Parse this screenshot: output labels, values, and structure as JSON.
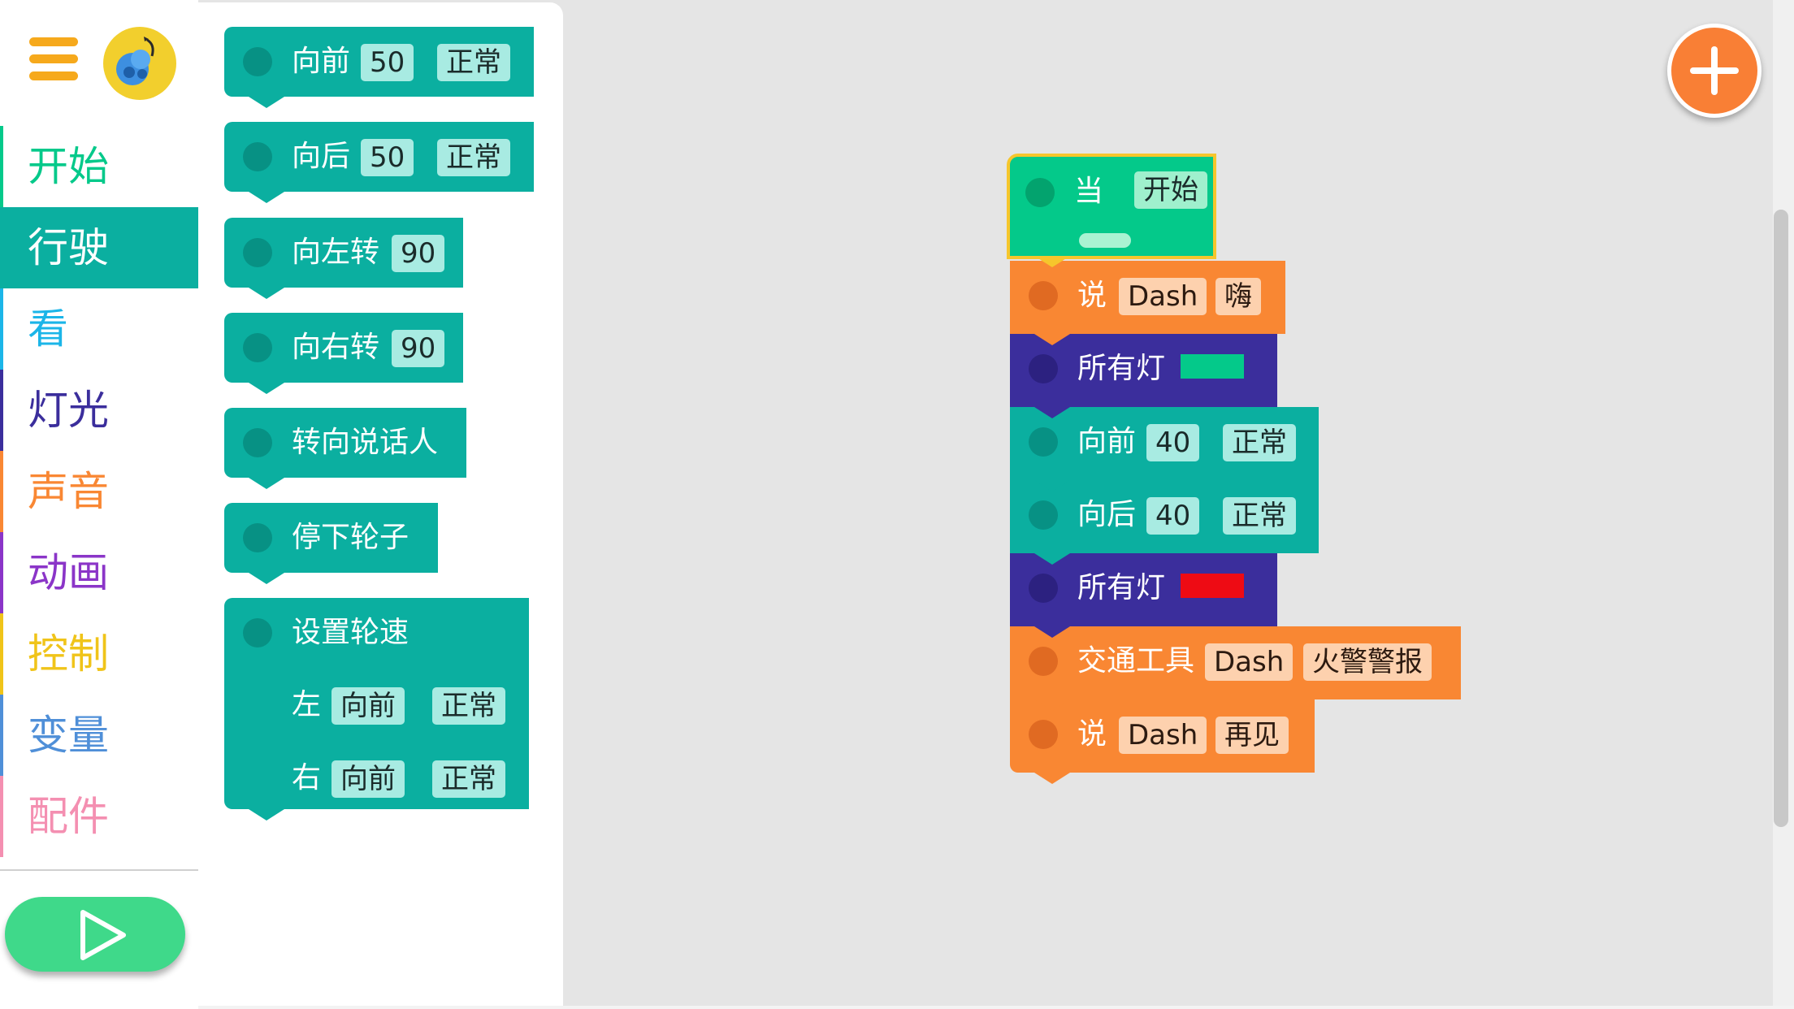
{
  "sidebar": {
    "categories": [
      {
        "label": "开始",
        "color": "#04c98a"
      },
      {
        "label": "行驶",
        "color": "#0bafa0"
      },
      {
        "label": "看",
        "color": "#1bb5e8"
      },
      {
        "label": "灯光",
        "color": "#3b2e9c"
      },
      {
        "label": "声音",
        "color": "#f98733"
      },
      {
        "label": "动画",
        "color": "#8b35c8"
      },
      {
        "label": "控制",
        "color": "#f0c419"
      },
      {
        "label": "变量",
        "color": "#4f8fd8"
      },
      {
        "label": "配件",
        "color": "#f48fb1"
      }
    ],
    "selected": "行驶",
    "menu_icon": "hamburger-menu-icon",
    "avatar_icon": "dash-robot-avatar-icon",
    "run_icon": "play-icon"
  },
  "palette": {
    "forward": {
      "label": "向前",
      "value": "50",
      "speed": "正常"
    },
    "backward": {
      "label": "向后",
      "value": "50",
      "speed": "正常"
    },
    "turn_left": {
      "label": "向左转",
      "value": "90"
    },
    "turn_right": {
      "label": "向右转",
      "value": "90"
    },
    "turn_to_speaker": {
      "label": "转向说话人"
    },
    "stop_wheels": {
      "label": "停下轮子"
    },
    "set_wheel_speed": {
      "label": "设置轮速",
      "left_label": "左",
      "left_direction": "向前",
      "left_speed": "正常",
      "right_label": "右",
      "right_direction": "向前",
      "right_speed": "正常"
    }
  },
  "workspace": {
    "when_start": {
      "label": "当",
      "event": "开始"
    },
    "say_hi": {
      "label": "说",
      "robot": "Dash",
      "phrase": "嗨"
    },
    "lights_green": {
      "label": "所有灯",
      "color": "#04c98a"
    },
    "forward": {
      "label": "向前",
      "value": "40",
      "speed": "正常"
    },
    "backward": {
      "label": "向后",
      "value": "40",
      "speed": "正常"
    },
    "lights_red": {
      "label": "所有灯",
      "color": "#ee0b14"
    },
    "vehicle": {
      "label": "交通工具",
      "robot": "Dash",
      "sound": "火警警报"
    },
    "say_bye": {
      "label": "说",
      "robot": "Dash",
      "phrase": "再见"
    }
  },
  "add_button_icon": "plus-icon"
}
